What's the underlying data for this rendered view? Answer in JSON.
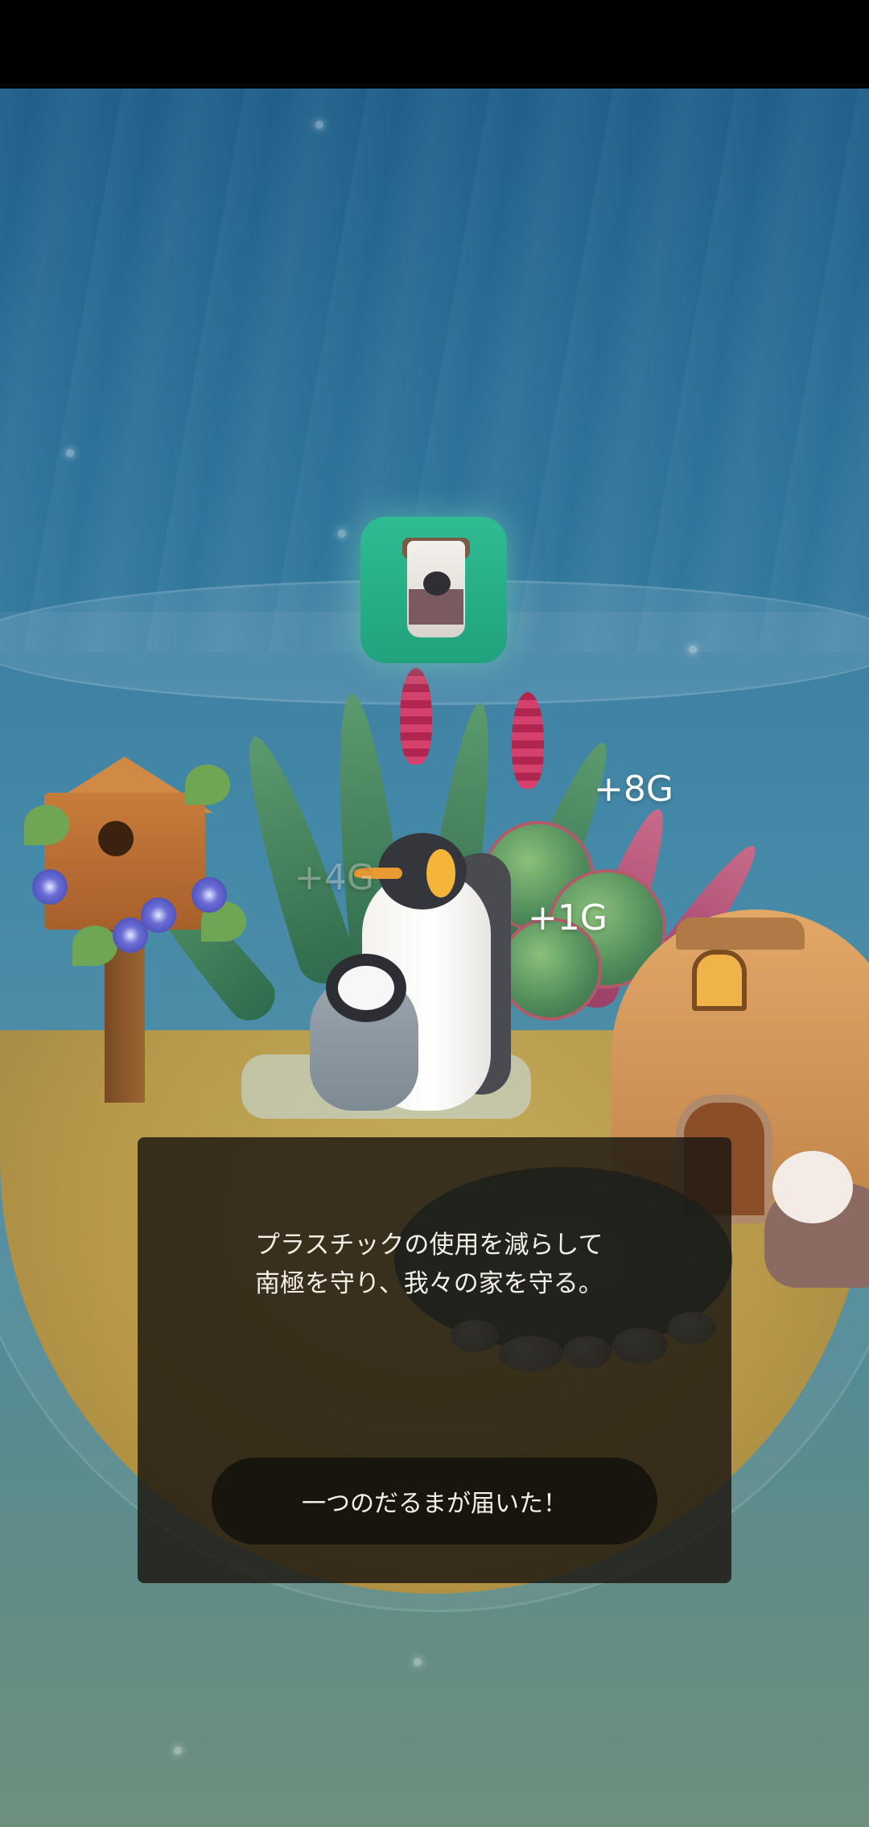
{
  "colors": {
    "status_bar": "#000000",
    "water_top": "#1d5a86",
    "water_bottom": "#6e8f7d",
    "item_card": "#2fbc93",
    "dialog_bg": "#1e1912",
    "text": "#f4f0e8"
  },
  "item": {
    "icon": "penguin-coffee-cup-icon"
  },
  "rewards": {
    "top": "+8G",
    "middle": "+1G",
    "faded": "+4G"
  },
  "dialog": {
    "message": "プラスチックの使用を減らして\n南極を守り、我々の家を守る。",
    "button_label": "一つのだるまが届いた！"
  }
}
